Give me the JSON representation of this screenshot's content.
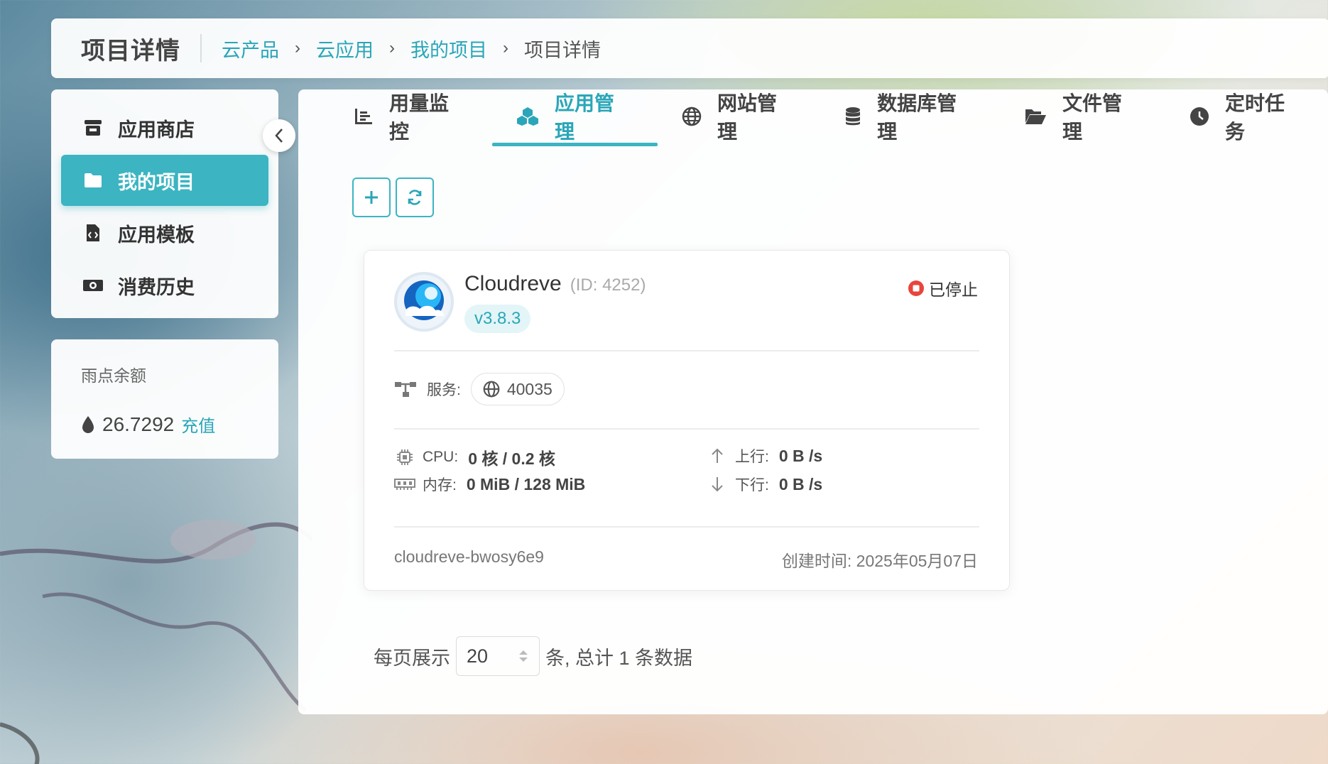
{
  "header": {
    "title": "项目详情",
    "breadcrumbs": [
      "云产品",
      "云应用",
      "我的项目",
      "项目详情"
    ]
  },
  "sidebar": {
    "items": [
      {
        "label": "应用商店",
        "icon": "store-icon"
      },
      {
        "label": "我的项目",
        "icon": "folder-icon",
        "active": true
      },
      {
        "label": "应用模板",
        "icon": "file-code-icon"
      },
      {
        "label": "消费历史",
        "icon": "money-icon"
      }
    ]
  },
  "balance": {
    "label": "雨点余额",
    "value": "26.7292",
    "recharge_label": "充值"
  },
  "tabs": [
    {
      "label": "用量监控",
      "icon": "list-icon"
    },
    {
      "label": "应用管理",
      "icon": "cubes-icon",
      "active": true
    },
    {
      "label": "网站管理",
      "icon": "globe-icon"
    },
    {
      "label": "数据库管理",
      "icon": "database-icon"
    },
    {
      "label": "文件管理",
      "icon": "folder-open-icon"
    },
    {
      "label": "定时任务",
      "icon": "clock-icon"
    }
  ],
  "card": {
    "name": "Cloudreve",
    "id_text": "(ID: 4252)",
    "version": "v3.8.3",
    "status": "已停止",
    "service_label": "服务:",
    "port": "40035",
    "cpu_label": "CPU:",
    "cpu_value": "0 核 / 0.2 核",
    "mem_label": "内存:",
    "mem_value": "0 MiB / 128 MiB",
    "up_label": "上行:",
    "up_value": "0 B /s",
    "down_label": "下行:",
    "down_value": "0 B /s",
    "slug": "cloudreve-bwosy6e9",
    "created": "创建时间: 2025年05月07日"
  },
  "pager": {
    "prefix": "每页展示",
    "page_size": "20",
    "suffix": "条, 总计 1 条数据"
  },
  "colors": {
    "accent": "#3cb4c2",
    "link": "#2aa6b8",
    "stopped": "#e8453c"
  }
}
